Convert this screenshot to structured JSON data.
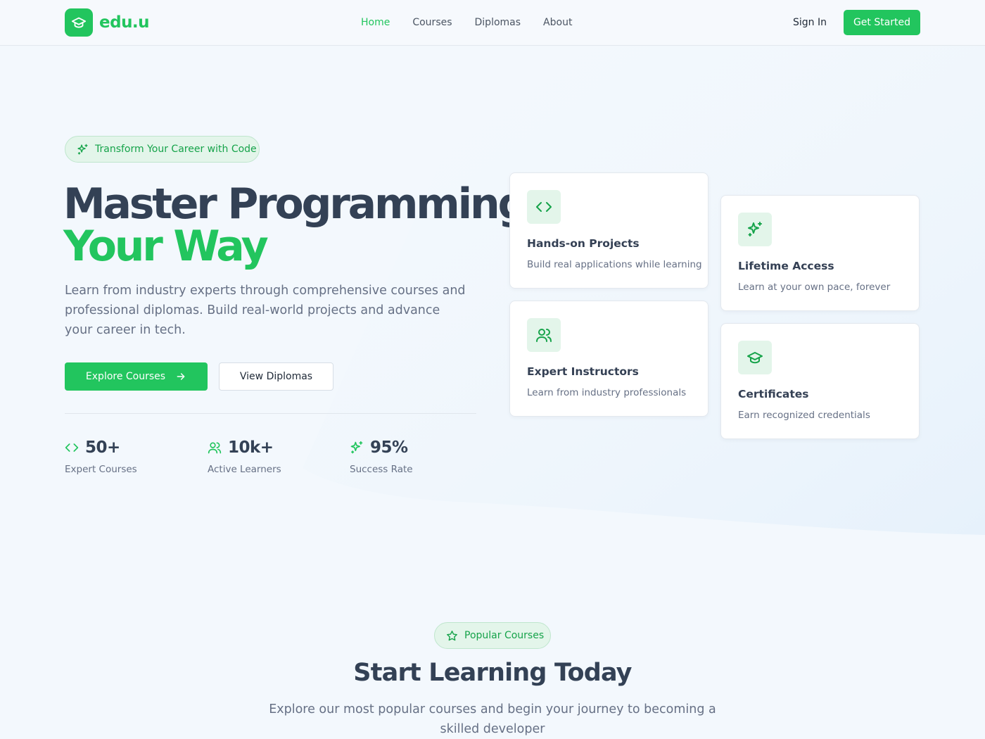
{
  "brand": {
    "name": "edu.u",
    "icon": "graduation-cap-icon"
  },
  "nav": {
    "links": [
      {
        "label": "Home",
        "active": true
      },
      {
        "label": "Courses",
        "active": false
      },
      {
        "label": "Diplomas",
        "active": false
      },
      {
        "label": "About",
        "active": false
      }
    ],
    "sign_in": "Sign In",
    "get_started": "Get Started"
  },
  "hero": {
    "badge": "Transform Your Career with Code",
    "badge_icon": "sparkles-icon",
    "title_line1": "Master Programming",
    "title_line2": "Your Way",
    "description": "Learn from industry experts through comprehensive courses and professional diplomas. Build real-world projects and advance your career in tech.",
    "primary_button": "Explore Courses",
    "secondary_button": "View Diplomas"
  },
  "stats": [
    {
      "icon": "code-icon",
      "value": "50+",
      "label": "Expert Courses"
    },
    {
      "icon": "users-icon",
      "value": "10k+",
      "label": "Active Learners"
    },
    {
      "icon": "sparkles-icon",
      "value": "95%",
      "label": "Success Rate"
    }
  ],
  "features": [
    {
      "icon": "code-icon",
      "title": "Hands-on Projects",
      "desc": "Build real applications while learning"
    },
    {
      "icon": "sparkles-icon",
      "title": "Lifetime Access",
      "desc": "Learn at your own pace, forever"
    },
    {
      "icon": "users-icon",
      "title": "Expert Instructors",
      "desc": "Learn from industry professionals"
    },
    {
      "icon": "graduation-cap-icon",
      "title": "Certificates",
      "desc": "Earn recognized credentials"
    }
  ],
  "popular": {
    "badge": "Popular Courses",
    "badge_icon": "star-icon",
    "title": "Start Learning Today",
    "description": "Explore our most popular courses and begin your journey to becoming a skilled developer"
  },
  "colors": {
    "accent": "#22c55e",
    "accent_soft": "#e3f5ea",
    "heading": "#334155",
    "muted": "#667085",
    "background": "#f3f8fd"
  }
}
